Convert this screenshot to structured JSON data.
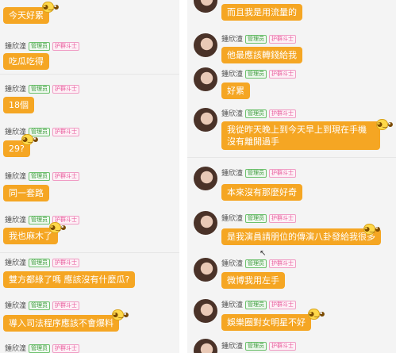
{
  "left": {
    "username": "鍾欣潼",
    "badges": {
      "admin": "管理员",
      "guard": "护群斗士"
    },
    "messages": [
      {
        "text": "今天好累"
      },
      {
        "text": "吃瓜吃得"
      },
      {
        "text": "18個"
      },
      {
        "text": "29?"
      },
      {
        "text": "同一套路"
      },
      {
        "text": "我也麻木了"
      },
      {
        "text": "雙方都綠了嗎 應該沒有什麼瓜?"
      },
      {
        "text": "導入司法程序應該不會爆料"
      }
    ]
  },
  "right": {
    "username": "鍾欣潼",
    "badges": {
      "admin": "管理员",
      "guard": "护群斗士"
    },
    "messages": [
      {
        "text": "而且我是用流量的"
      },
      {
        "text": "他最應該轉錢給我"
      },
      {
        "text": "好累"
      },
      {
        "text": "我從昨天晚上到今天早上到現在手機沒有離開過手"
      },
      {
        "text": "本來沒有那麼好奇"
      },
      {
        "text": "是我演員請朋位的傳演八卦發給我很多"
      },
      {
        "text": "微博我用左手"
      },
      {
        "text": "娛樂圈對女明星不好"
      }
    ]
  },
  "colors": {
    "bubble": "#f5a623",
    "admin_badge": "#3c9a3c",
    "guard_badge": "#e8589a"
  },
  "icons": {
    "emoji": "smiley-face-icon",
    "avatar": "user-avatar"
  }
}
